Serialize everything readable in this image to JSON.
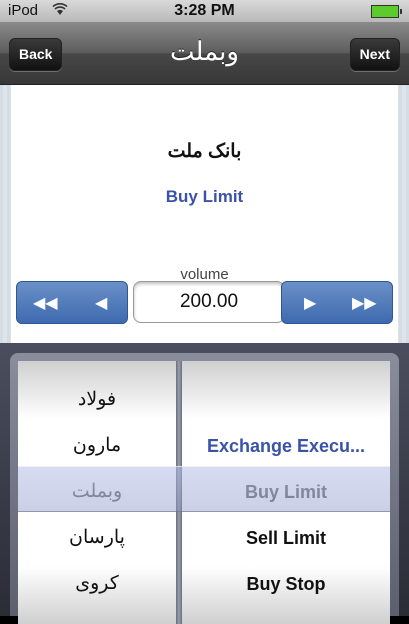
{
  "status_bar": {
    "carrier": "iPod",
    "wifi_icon": "wifi-icon",
    "time": "3:28 PM",
    "battery_icon": "battery-charging-icon"
  },
  "nav": {
    "title": "وبملت",
    "back_label": "Back",
    "next_label": "Next"
  },
  "order": {
    "symbol_name": "بانک ملت",
    "order_type": "Buy Limit"
  },
  "volume": {
    "label": "volume",
    "value": "200.00",
    "decrement_glyphs": {
      "fast": "◀◀",
      "step": "◀"
    },
    "increment_glyphs": {
      "step": "▶",
      "fast": "▶▶"
    }
  },
  "picker": {
    "symbols": [
      "فولاد",
      "مارون",
      "وبملت",
      "پارسان",
      "کروی"
    ],
    "order_types": [
      "",
      "Exchange Execu...",
      "Buy Limit",
      "Sell Limit",
      "Buy Stop"
    ],
    "selected_index": 2
  },
  "colors": {
    "accent_blue": "#3a52a8",
    "stepper_blue": "#4a75b8",
    "nav_dark": "#3c3c3c"
  }
}
